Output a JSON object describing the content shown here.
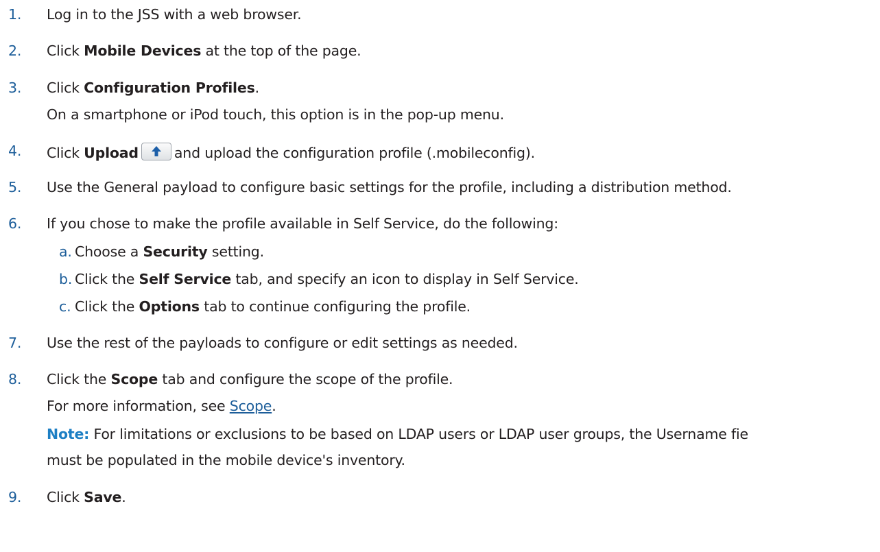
{
  "steps": [
    {
      "num": "1.",
      "text": "Log in to the JSS with a web browser."
    },
    {
      "num": "2.",
      "pre": "Click ",
      "bold": "Mobile Devices",
      "post": " at the top of the page."
    },
    {
      "num": "3.",
      "pre": "Click ",
      "bold": "Configuration Profiles",
      "post": ".",
      "detail": "On a smartphone or iPod touch, this option is in the pop-up menu."
    },
    {
      "num": "4.",
      "pre": "Click ",
      "bold": "Upload",
      "post": "and upload the configuration profile (.mobileconfig).",
      "icon": "upload-arrow-icon"
    },
    {
      "num": "5.",
      "text": "Use the General payload to configure basic settings for the profile, including a distribution method."
    },
    {
      "num": "6.",
      "text": "If you chose to make the profile available in Self Service, do the following:",
      "substeps": [
        {
          "letter": "a.",
          "pre": "Choose a ",
          "bold": "Security",
          "post": " setting."
        },
        {
          "letter": "b.",
          "pre": "Click the ",
          "bold": "Self Service",
          "post": " tab, and specify an icon to display in Self Service."
        },
        {
          "letter": "c.",
          "pre": "Click the ",
          "bold": "Options",
          "post": " tab to continue configuring the profile."
        }
      ]
    },
    {
      "num": "7.",
      "text": "Use the rest of the payloads to configure or edit settings as needed."
    },
    {
      "num": "8.",
      "pre": "Click the ",
      "bold": "Scope",
      "post": " tab and configure the scope of the profile.",
      "detail_pre": "For more information, see ",
      "detail_link": "Scope",
      "detail_post": ".",
      "note_label": "Note:",
      "note_text": " For limitations or exclusions to be based on LDAP users or LDAP user groups, the Username fie",
      "note_text2": "must be populated in the mobile device's inventory."
    },
    {
      "num": "9.",
      "pre": "Click ",
      "bold": "Save",
      "post": "."
    }
  ],
  "colors": {
    "step_number": "#1d5e9a",
    "note_label": "#1d7fc4",
    "body_text": "#231f20",
    "upload_arrow": "#1d5fa8"
  }
}
